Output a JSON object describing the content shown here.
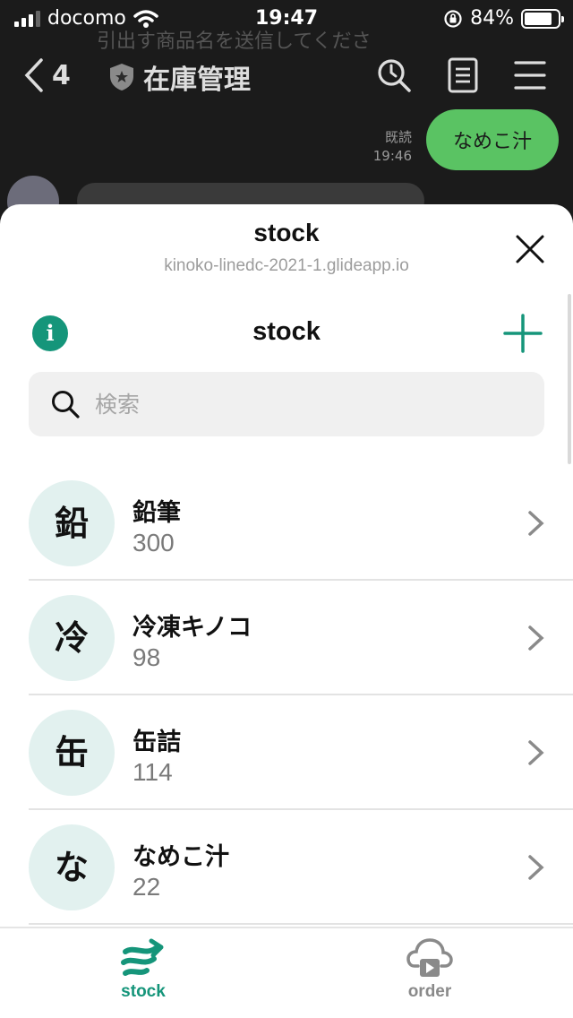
{
  "status": {
    "carrier": "docomo",
    "time": "19:47",
    "battery": "84%",
    "battery_level": 0.84
  },
  "chat": {
    "back_count": "4",
    "title": "在庫管理",
    "ghost_text": "引出す商品名を送信してくださ",
    "read_label": "既読",
    "message_time": "19:46",
    "my_message": "なめこ汁",
    "icons": [
      "search-history-icon",
      "notes-icon",
      "menu-icon"
    ]
  },
  "sheet": {
    "title": "stock",
    "url": "kinoko-linedc-2021-1.glideapp.io"
  },
  "app": {
    "title": "stock",
    "search_placeholder": "検索",
    "accent": "#15957a",
    "items": [
      {
        "initial": "鉛",
        "name": "鉛筆",
        "qty": "300"
      },
      {
        "initial": "冷",
        "name": "冷凍キノコ",
        "qty": "98"
      },
      {
        "initial": "缶",
        "name": "缶詰",
        "qty": "114"
      },
      {
        "initial": "な",
        "name": "なめこ汁",
        "qty": "22"
      }
    ],
    "tabs": [
      {
        "label": "stock",
        "icon": "stock-arrows-icon",
        "active": true
      },
      {
        "label": "order",
        "icon": "cloud-play-icon",
        "active": false
      }
    ]
  }
}
